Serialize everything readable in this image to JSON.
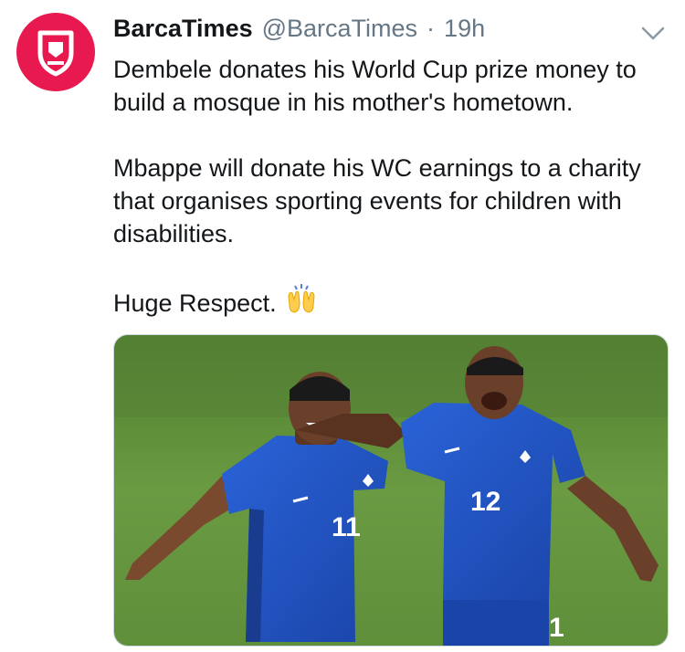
{
  "tweet": {
    "display_name": "BarcaTimes",
    "handle": "@BarcaTimes",
    "separator": "·",
    "time": "19h",
    "paragraphs": [
      "Dembele donates his World Cup prize money to build a mosque in his mother's hometown.",
      "Mbappe will donate his WC earnings to a charity that organises sporting events for children with disabilities.",
      "Huge Respect."
    ],
    "emoji_icon": "raising-hands-icon",
    "media": {
      "left_player_number": "11",
      "right_player_number": "12",
      "right_player_partial_number": "1"
    }
  },
  "colors": {
    "brand": "#e8194e",
    "secondary_text": "#657786",
    "kit_blue": "#1f56c9",
    "pitch_green": "#5f8f3a"
  }
}
